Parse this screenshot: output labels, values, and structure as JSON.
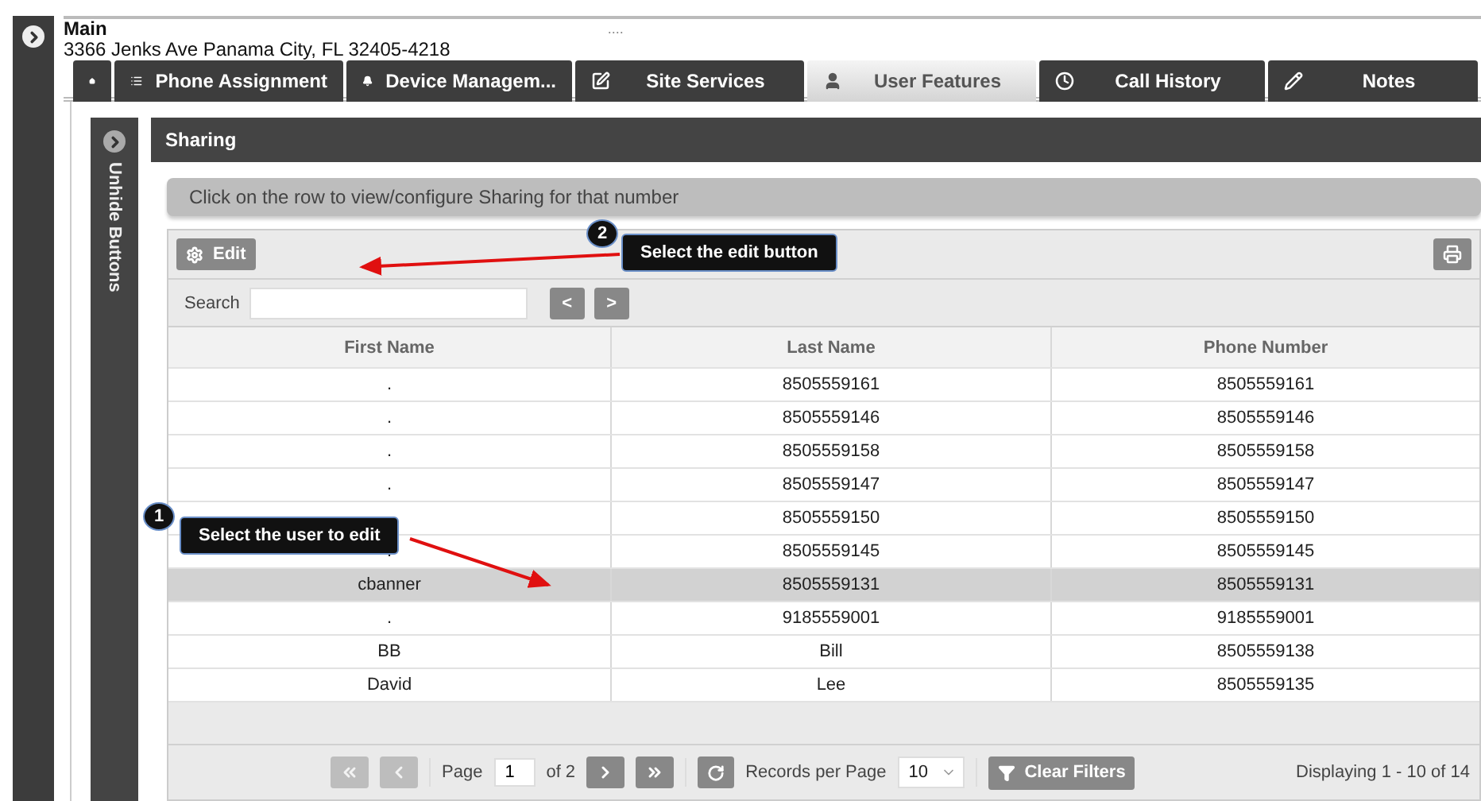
{
  "header": {
    "title": "Main",
    "address": "3366 Jenks Ave Panama City, FL 32405-4218",
    "marker": "...."
  },
  "tabs": [
    {
      "kind": "home",
      "selected": false
    },
    {
      "kind": "list",
      "label": "Phone Assignment",
      "selected": false
    },
    {
      "kind": "bell",
      "label": "Device Managem...",
      "selected": false
    },
    {
      "kind": "edit",
      "label": "Site Services",
      "selected": false
    },
    {
      "kind": "user",
      "label": "User Features",
      "selected": true
    },
    {
      "kind": "clock",
      "label": "Call History",
      "selected": false
    },
    {
      "kind": "pencil",
      "label": "Notes",
      "selected": false
    }
  ],
  "side_strip": {
    "label": "Unhide Buttons"
  },
  "panel": {
    "title": "Sharing",
    "hint": "Click on the row to view/configure Sharing for that number",
    "edit_button": "Edit",
    "search_label": "Search",
    "prev": "<",
    "next": ">"
  },
  "table": {
    "columns": [
      "First Name",
      "Last Name",
      "Phone Number"
    ],
    "rows": [
      {
        "cells": [
          ".",
          "8505559161",
          "8505559161"
        ],
        "selected": false
      },
      {
        "cells": [
          ".",
          "8505559146",
          "8505559146"
        ],
        "selected": false
      },
      {
        "cells": [
          ".",
          "8505559158",
          "8505559158"
        ],
        "selected": false
      },
      {
        "cells": [
          ".",
          "8505559147",
          "8505559147"
        ],
        "selected": false
      },
      {
        "cells": [
          null,
          "8505559150",
          "8505559150"
        ],
        "selected": false
      },
      {
        "cells": [
          ".",
          "8505559145",
          "8505559145"
        ],
        "selected": false
      },
      {
        "cells": [
          "cbanner",
          "8505559131",
          "8505559131"
        ],
        "selected": true
      },
      {
        "cells": [
          ".",
          "9185559001",
          "9185559001"
        ],
        "selected": false
      },
      {
        "cells": [
          "BB",
          "Bill",
          "8505559138"
        ],
        "selected": false
      },
      {
        "cells": [
          "David",
          "Lee",
          "8505559135"
        ],
        "selected": false
      }
    ]
  },
  "pager": {
    "first_disabled": true,
    "prev_disabled": true,
    "page_label": "Page",
    "page": "1",
    "of": "of 2",
    "records_label": "Records per Page",
    "per_page": "10",
    "clear_filters": "Clear Filters",
    "display": "Displaying 1 - 10 of 14"
  },
  "annotations": [
    {
      "number": "2",
      "text": "Select the edit button"
    },
    {
      "number": "1",
      "text": "Select the user to edit"
    }
  ]
}
